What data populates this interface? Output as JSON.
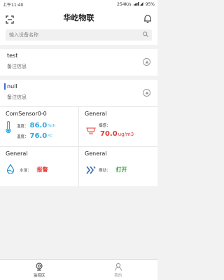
{
  "status": {
    "time": "上午11:40",
    "speed": "254K/s",
    "battery": "95%"
  },
  "header": {
    "title": "华屹物联"
  },
  "search": {
    "placeholder": "输入设备名称"
  },
  "groups": [
    {
      "name": "test",
      "note": "备注信息"
    },
    {
      "name": "null",
      "note": "备注信息"
    }
  ],
  "cards": {
    "sensor": {
      "title": "ComSensor0-0",
      "humidity_label": "湿度：",
      "humidity_value": "86.0",
      "humidity_unit": "%rh",
      "temp_label": "温度：",
      "temp_value": "76.0",
      "temp_unit": "°C"
    },
    "smoke": {
      "title": "General",
      "label": "烟感：",
      "value": "70.0",
      "unit": "ug/m3"
    },
    "water": {
      "title": "General",
      "label": "水浸：",
      "value": "报警"
    },
    "vibration": {
      "title": "General",
      "label": "振动：",
      "value": "打开"
    }
  },
  "tabs": [
    {
      "label": "监控区",
      "icon": "camera-icon"
    },
    {
      "label": "我的",
      "icon": "person-icon"
    }
  ],
  "colors": {
    "accent": "#3a6cd8",
    "value_blue": "#29a9e0",
    "alarm_red": "#e53935",
    "on_green": "#2e9f3a"
  }
}
